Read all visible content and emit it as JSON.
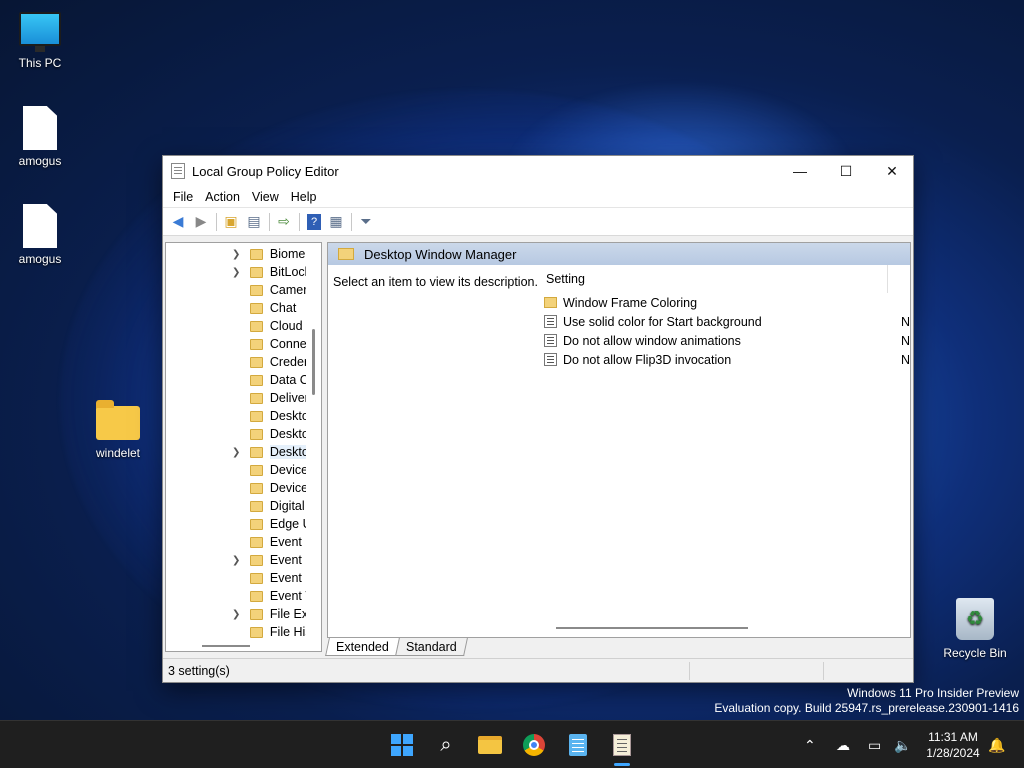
{
  "desktop": {
    "icons": [
      {
        "label": "This PC"
      },
      {
        "label": "amogus"
      },
      {
        "label": "amogus"
      },
      {
        "label": "windelet"
      },
      {
        "label": "Recycle Bin"
      }
    ],
    "watermark": {
      "line1": "Windows 11 Pro Insider Preview",
      "line2": "Evaluation copy. Build 25947.rs_prerelease.230901-1416"
    }
  },
  "window": {
    "title": "Local Group Policy Editor",
    "controls": {
      "minimize": "—",
      "maximize": "☐",
      "close": "✕"
    },
    "menu": [
      "File",
      "Action",
      "View",
      "Help"
    ],
    "toolbar": [
      "back-icon",
      "forward-icon",
      "up-folder-icon",
      "show-hide-tree-icon",
      "export-list-icon",
      "help-icon",
      "properties-icon",
      "filter-icon"
    ],
    "tree": {
      "items": [
        {
          "label": "Biome",
          "expandable": true
        },
        {
          "label": "BitLocl",
          "expandable": true
        },
        {
          "label": "Camer",
          "expandable": false
        },
        {
          "label": "Chat",
          "expandable": false
        },
        {
          "label": "Cloud",
          "expandable": false
        },
        {
          "label": "Conne",
          "expandable": false
        },
        {
          "label": "Creder",
          "expandable": false
        },
        {
          "label": "Data C",
          "expandable": false
        },
        {
          "label": "Deliver",
          "expandable": false
        },
        {
          "label": "Deskto",
          "expandable": false
        },
        {
          "label": "Deskto",
          "expandable": false
        },
        {
          "label": "Deskto",
          "expandable": true,
          "selected": true
        },
        {
          "label": "Device",
          "expandable": false
        },
        {
          "label": "Device",
          "expandable": false
        },
        {
          "label": "Digital",
          "expandable": false
        },
        {
          "label": "Edge U",
          "expandable": false
        },
        {
          "label": "Event F",
          "expandable": false
        },
        {
          "label": "Event L",
          "expandable": true
        },
        {
          "label": "Event L",
          "expandable": false
        },
        {
          "label": "Event V",
          "expandable": false
        },
        {
          "label": "File Exp",
          "expandable": true
        },
        {
          "label": "File His",
          "expandable": false
        }
      ]
    },
    "details": {
      "header": "Desktop Window Manager",
      "description": "Select an item to view its description.",
      "column": "Setting",
      "rows": [
        {
          "label": "Window Frame Coloring",
          "type": "folder",
          "state": ""
        },
        {
          "label": "Use solid color for Start background",
          "type": "setting",
          "state": "N"
        },
        {
          "label": "Do not allow window animations",
          "type": "setting",
          "state": "N"
        },
        {
          "label": "Do not allow Flip3D invocation",
          "type": "setting",
          "state": "N"
        }
      ]
    },
    "tabs": [
      "Extended",
      "Standard"
    ],
    "status": "3 setting(s)"
  },
  "taskbar": {
    "clock": {
      "time": "11:31 AM",
      "date": "1/28/2024"
    }
  }
}
